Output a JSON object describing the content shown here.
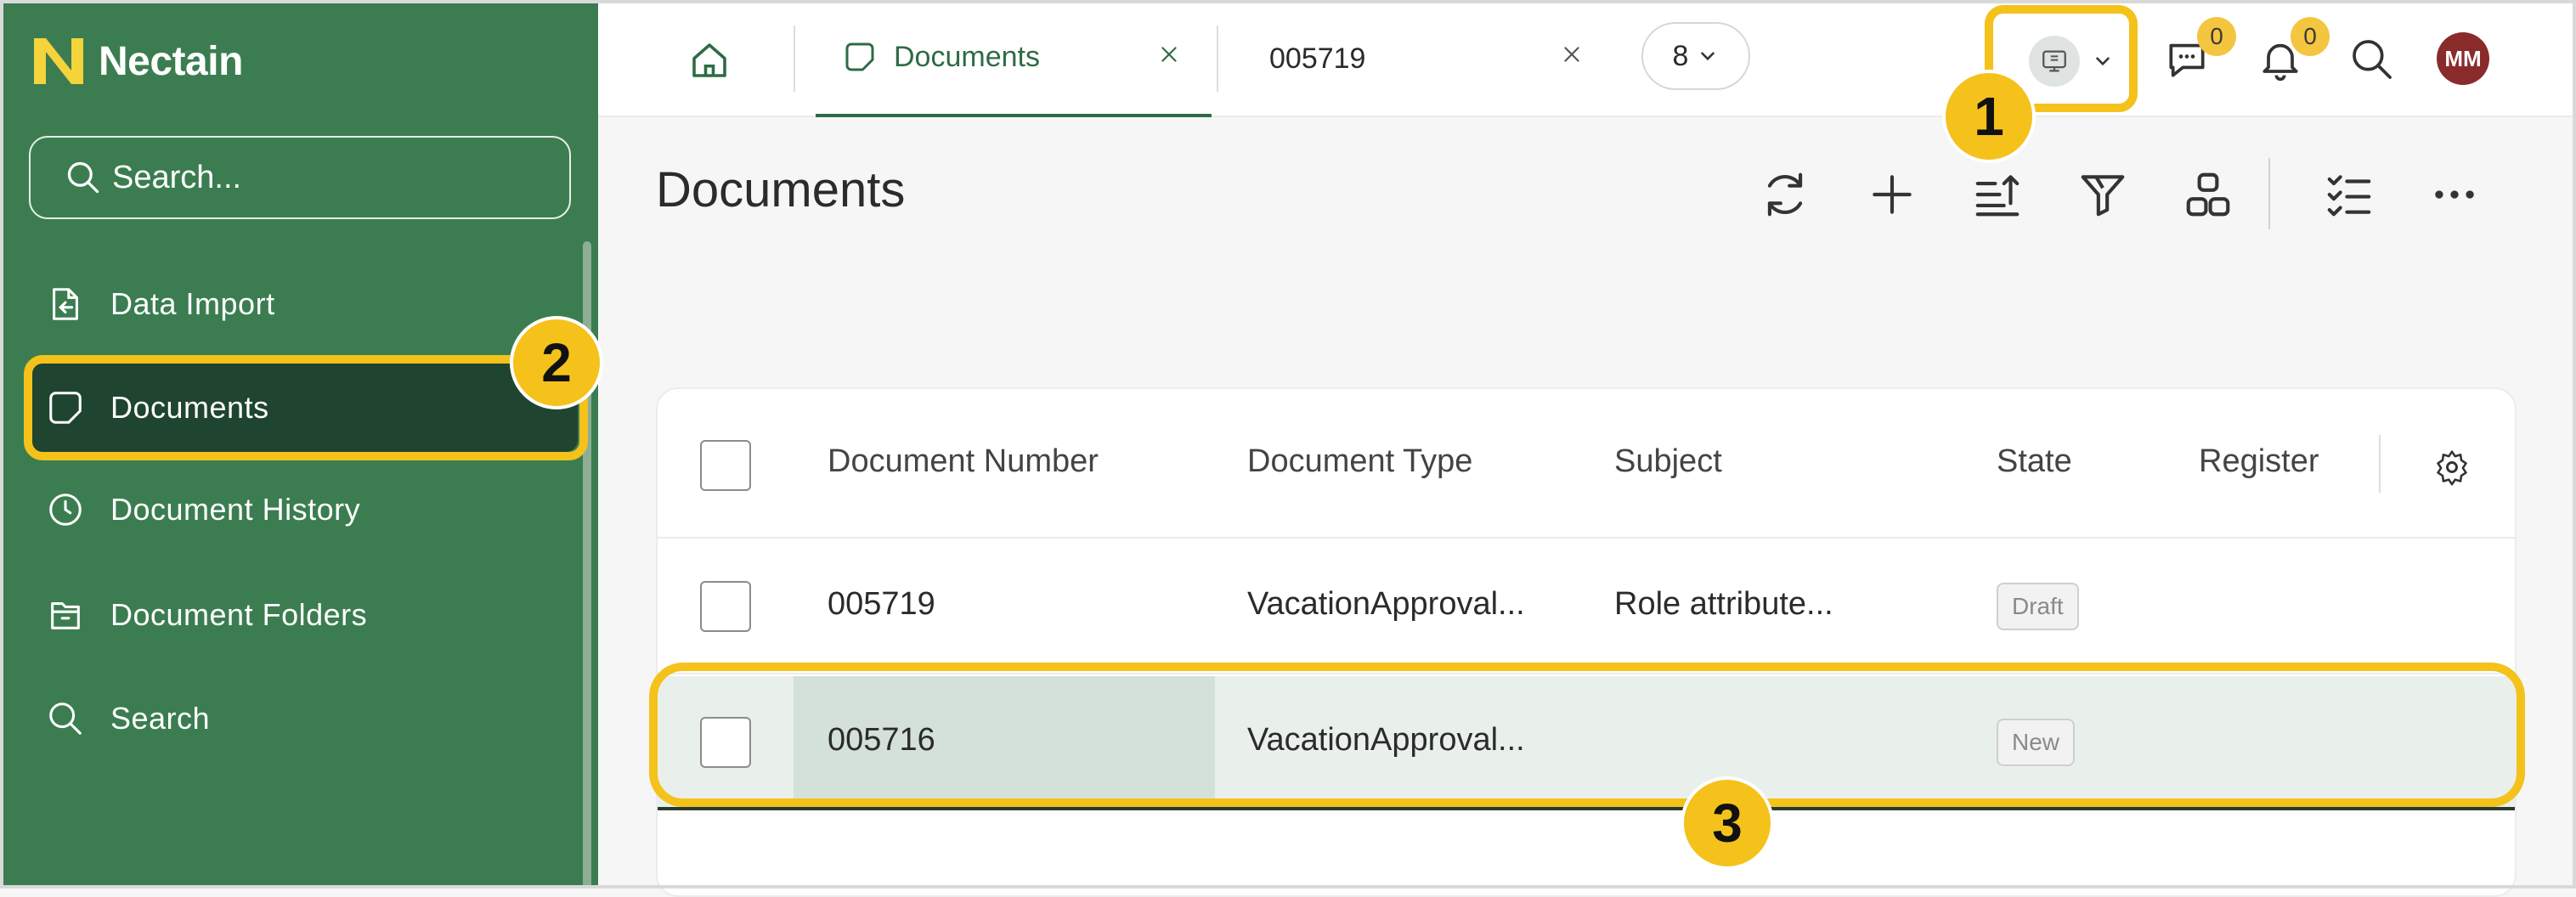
{
  "app": {
    "name": "Nectain"
  },
  "sidebar": {
    "search_placeholder": "Search...",
    "items": [
      {
        "label": "Data Import",
        "icon": "file-import-icon"
      },
      {
        "label": "Documents",
        "icon": "document-icon",
        "active": true
      },
      {
        "label": "Document History",
        "icon": "clock-icon"
      },
      {
        "label": "Document Folders",
        "icon": "folder-icon"
      },
      {
        "label": "Search",
        "icon": "search-icon"
      }
    ]
  },
  "topbar": {
    "tabs": [
      {
        "label": "Documents",
        "active": true
      },
      {
        "label": "005719",
        "active": false
      }
    ],
    "more_tabs_count": "8",
    "messages_count": "0",
    "notifications_count": "0",
    "avatar_initials": "MM"
  },
  "page": {
    "title": "Documents"
  },
  "table": {
    "columns": [
      "Document Number",
      "Document Type",
      "Subject",
      "State",
      "Register"
    ],
    "rows": [
      {
        "number": "005719",
        "type": "VacationApproval...",
        "subject": "Role attribute...",
        "state": "Draft"
      },
      {
        "number": "005716",
        "type": "VacationApproval...",
        "subject": "",
        "state": "New"
      }
    ]
  },
  "annotations": {
    "m1": "1",
    "m2": "2",
    "m3": "3"
  },
  "colors": {
    "sidebar": "#3b7d51",
    "sidebar_active": "#1f4430",
    "accent": "#2e6b45",
    "highlight": "#f4c21b",
    "badge": "#f4c53e",
    "avatar": "#8a2b2b"
  }
}
